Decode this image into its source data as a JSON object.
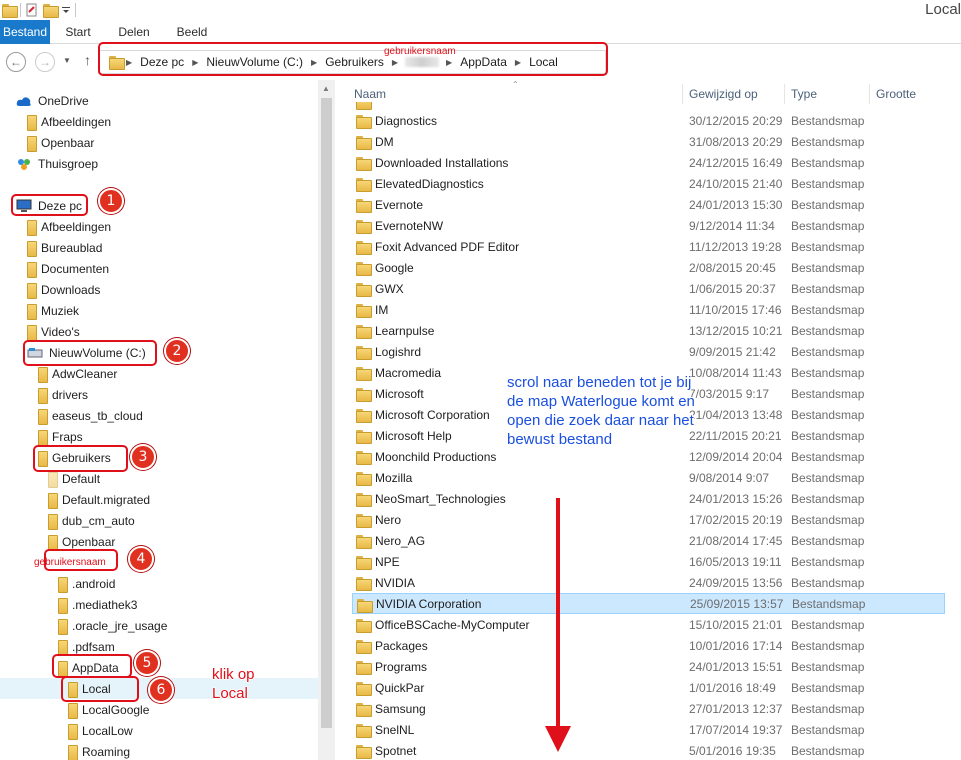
{
  "window": {
    "title": "Local"
  },
  "ribbon": {
    "tabs": [
      "Bestand",
      "Start",
      "Delen",
      "Beeld"
    ]
  },
  "address": {
    "crumbs": [
      "Deze pc",
      "NieuwVolume (C:)",
      "Gebruikers",
      "AppData",
      "Local"
    ],
    "redacted_label": "gebruikersnaam"
  },
  "nav": {
    "items": [
      {
        "label": "OneDrive",
        "icon": "cloud-icon"
      },
      {
        "label": "Afbeeldingen",
        "icon": "folder-icon"
      },
      {
        "label": "Openbaar",
        "icon": "folder-icon"
      },
      {
        "label": "Thuisgroep",
        "icon": "homegroup-icon"
      },
      {
        "label": "Deze pc",
        "icon": "computer-icon"
      },
      {
        "label": "Afbeeldingen",
        "icon": "folder-icon"
      },
      {
        "label": "Bureaublad",
        "icon": "folder-icon"
      },
      {
        "label": "Documenten",
        "icon": "folder-icon"
      },
      {
        "label": "Downloads",
        "icon": "folder-icon"
      },
      {
        "label": "Muziek",
        "icon": "folder-icon"
      },
      {
        "label": "Video's",
        "icon": "folder-icon"
      },
      {
        "label": "NieuwVolume (C:)",
        "icon": "drive-icon"
      },
      {
        "label": "AdwCleaner",
        "icon": "folder-icon"
      },
      {
        "label": "drivers",
        "icon": "folder-icon"
      },
      {
        "label": "easeus_tb_cloud",
        "icon": "folder-icon"
      },
      {
        "label": "Fraps",
        "icon": "folder-icon"
      },
      {
        "label": "Gebruikers",
        "icon": "folder-icon"
      },
      {
        "label": "Default",
        "icon": "folder-icon"
      },
      {
        "label": "Default.migrated",
        "icon": "folder-icon"
      },
      {
        "label": "dub_cm_auto",
        "icon": "folder-icon"
      },
      {
        "label": "Openbaar",
        "icon": "folder-icon"
      },
      {
        "label": "gebruikersnaam",
        "icon": "folder-icon"
      },
      {
        "label": ".android",
        "icon": "folder-icon"
      },
      {
        "label": ".mediathek3",
        "icon": "folder-icon"
      },
      {
        "label": ".oracle_jre_usage",
        "icon": "folder-icon"
      },
      {
        "label": ".pdfsam",
        "icon": "folder-icon"
      },
      {
        "label": "AppData",
        "icon": "folder-icon"
      },
      {
        "label": "Local",
        "icon": "folder-icon"
      },
      {
        "label": "LocalGoogle",
        "icon": "folder-icon"
      },
      {
        "label": "LocalLow",
        "icon": "folder-icon"
      },
      {
        "label": "Roaming",
        "icon": "folder-icon"
      }
    ]
  },
  "list": {
    "columns": {
      "name": "Naam",
      "modified": "Gewijzigd op",
      "type": "Type",
      "size": "Grootte"
    },
    "rows": [
      {
        "name": "Diagnostics",
        "modified": "30/12/2015 20:29",
        "type": "Bestandsmap"
      },
      {
        "name": "DM",
        "modified": "31/08/2013 20:29",
        "type": "Bestandsmap"
      },
      {
        "name": "Downloaded Installations",
        "modified": "24/12/2015 16:49",
        "type": "Bestandsmap"
      },
      {
        "name": "ElevatedDiagnostics",
        "modified": "24/10/2015 21:40",
        "type": "Bestandsmap"
      },
      {
        "name": "Evernote",
        "modified": "24/01/2013 15:30",
        "type": "Bestandsmap"
      },
      {
        "name": "EvernoteNW",
        "modified": "9/12/2014 11:34",
        "type": "Bestandsmap"
      },
      {
        "name": "Foxit Advanced PDF Editor",
        "modified": "11/12/2013 19:28",
        "type": "Bestandsmap"
      },
      {
        "name": "Google",
        "modified": "2/08/2015 20:45",
        "type": "Bestandsmap"
      },
      {
        "name": "GWX",
        "modified": "1/06/2015 20:37",
        "type": "Bestandsmap"
      },
      {
        "name": "IM",
        "modified": "11/10/2015 17:46",
        "type": "Bestandsmap"
      },
      {
        "name": "Learnpulse",
        "modified": "13/12/2015 10:21",
        "type": "Bestandsmap"
      },
      {
        "name": "Logishrd",
        "modified": "9/09/2015 21:42",
        "type": "Bestandsmap"
      },
      {
        "name": "Macromedia",
        "modified": "10/08/2014 11:43",
        "type": "Bestandsmap"
      },
      {
        "name": "Microsoft",
        "modified": "7/03/2015 9:17",
        "type": "Bestandsmap"
      },
      {
        "name": "Microsoft Corporation",
        "modified": "21/04/2013 13:48",
        "type": "Bestandsmap"
      },
      {
        "name": "Microsoft Help",
        "modified": "22/11/2015 20:21",
        "type": "Bestandsmap"
      },
      {
        "name": "Moonchild Productions",
        "modified": "12/09/2014 20:04",
        "type": "Bestandsmap"
      },
      {
        "name": "Mozilla",
        "modified": "9/08/2014 9:07",
        "type": "Bestandsmap"
      },
      {
        "name": "NeoSmart_Technologies",
        "modified": "24/01/2013 15:26",
        "type": "Bestandsmap"
      },
      {
        "name": "Nero",
        "modified": "17/02/2015 20:19",
        "type": "Bestandsmap"
      },
      {
        "name": "Nero_AG",
        "modified": "21/08/2014 17:45",
        "type": "Bestandsmap"
      },
      {
        "name": "NPE",
        "modified": "16/05/2013 19:11",
        "type": "Bestandsmap"
      },
      {
        "name": "NVIDIA",
        "modified": "24/09/2015 13:56",
        "type": "Bestandsmap"
      },
      {
        "name": "NVIDIA Corporation",
        "modified": "25/09/2015 13:57",
        "type": "Bestandsmap"
      },
      {
        "name": "OfficeBSCache-MyComputer",
        "modified": "15/10/2015 21:01",
        "type": "Bestandsmap"
      },
      {
        "name": "Packages",
        "modified": "10/01/2016 17:14",
        "type": "Bestandsmap"
      },
      {
        "name": "Programs",
        "modified": "24/01/2013 15:51",
        "type": "Bestandsmap"
      },
      {
        "name": "QuickPar",
        "modified": "1/01/2016 18:49",
        "type": "Bestandsmap"
      },
      {
        "name": "Samsung",
        "modified": "27/01/2013 12:37",
        "type": "Bestandsmap"
      },
      {
        "name": "SnelNL",
        "modified": "17/07/2014 19:37",
        "type": "Bestandsmap"
      },
      {
        "name": "Spotnet",
        "modified": "5/01/2016 19:35",
        "type": "Bestandsmap"
      }
    ]
  },
  "annotations": {
    "steps": [
      "1",
      "2",
      "3",
      "4",
      "5",
      "6"
    ],
    "click_local": "klik op\nLocal",
    "instruction": "scrol naar beneden tot je bij de map Waterlogue komt en open die zoek daar naar het bewust bestand"
  },
  "colors": {
    "accent": "#1979ca",
    "annotation_red": "#e0101a",
    "annotation_blue": "#1a4fe0",
    "selection": "#cce8ff"
  }
}
